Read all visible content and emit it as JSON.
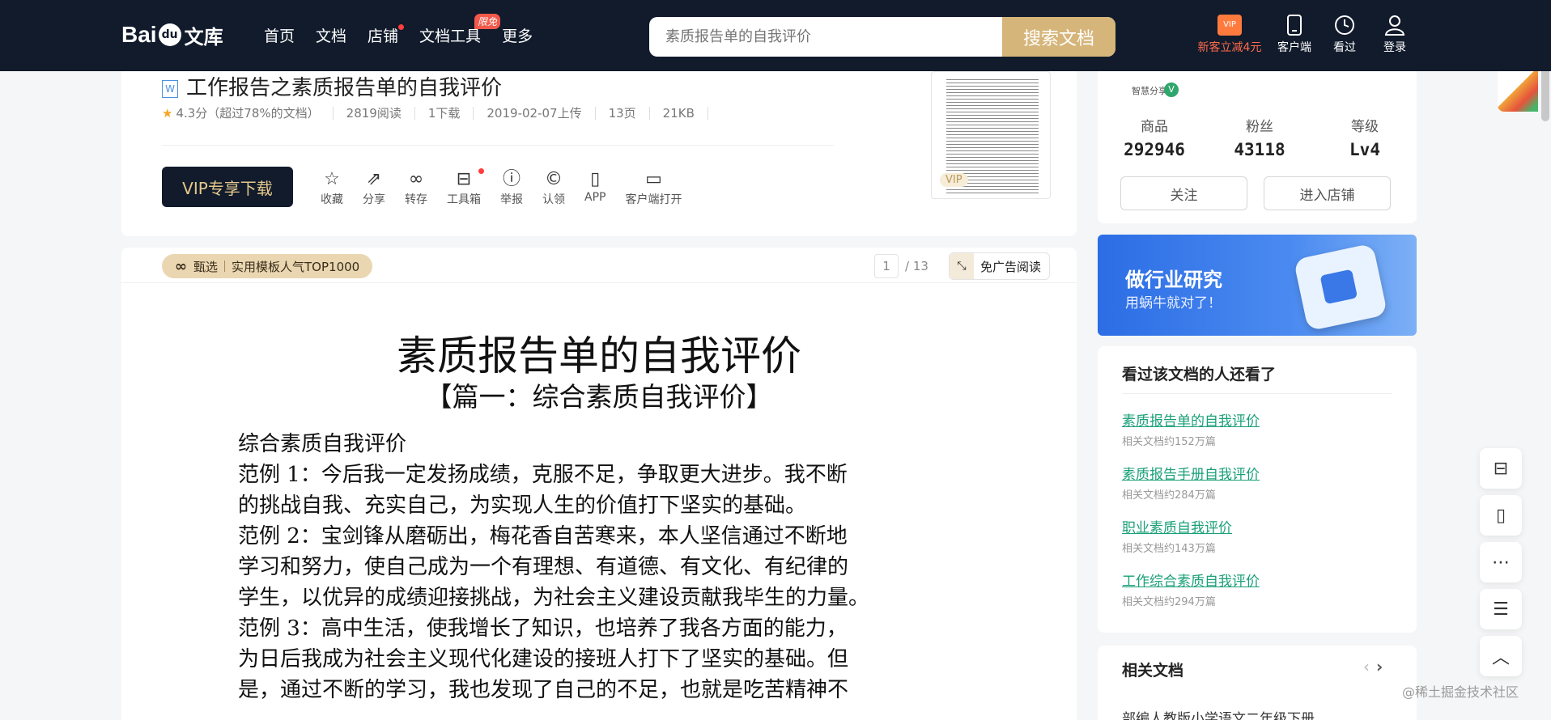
{
  "header": {
    "logo_bai": "Bai",
    "logo_du": "du",
    "logo_wenku": "文库",
    "nav": [
      {
        "label": "首页"
      },
      {
        "label": "文档"
      },
      {
        "label": "店铺"
      },
      {
        "label": "文档工具",
        "tag": "限免"
      },
      {
        "label": "更多"
      }
    ],
    "search_placeholder": "素质报告单的自我评价",
    "search_button": "搜索文档",
    "vip_promo": "新客立减4元",
    "vip_gift_text": "VIP",
    "tools": [
      {
        "label": "客户端",
        "icon": "tablet-icon"
      },
      {
        "label": "看过",
        "icon": "clock-icon"
      },
      {
        "label": "登录",
        "icon": "user-icon"
      }
    ]
  },
  "doc": {
    "type_icon": "W",
    "title": "工作报告之素质报告单的自我评价",
    "meta": {
      "rating": "4.3分（超过78%的文档）",
      "reads": "2819阅读",
      "downloads": "1下载",
      "upload_date": "2019-02-07上传",
      "pages": "13页",
      "size": "21KB"
    },
    "vip_download": "VIP专享下载",
    "actions": [
      {
        "label": "收藏",
        "icon": "☆"
      },
      {
        "label": "分享",
        "icon": "⇗"
      },
      {
        "label": "转存",
        "icon": "∞"
      },
      {
        "label": "工具箱",
        "icon": "⊟"
      },
      {
        "label": "举报",
        "icon": "ⓘ"
      },
      {
        "label": "认领",
        "icon": "©"
      },
      {
        "label": "APP",
        "icon": "▯"
      },
      {
        "label": "客户端打开",
        "icon": "▭"
      }
    ],
    "thumb_tag": "VIP"
  },
  "reader": {
    "zhenxuan": "甄选",
    "zhenxuan_sub": "实用模板人气TOP1000",
    "page_current": "1",
    "page_total": "/ 13",
    "noad_label": "免广告阅读",
    "page_title": "素质报告单的自我评价",
    "page_subtitle": "【篇一：综合素质自我评价】",
    "body": [
      " 综合素质自我评价",
      " 范例 1：今后我一定发扬成绩，克服不足，争取更大进步。我不断",
      "的挑战自我、充实自己，为实现人生的价值打下坚实的基础。",
      " 范例 2：宝剑锋从磨砺出，梅花香自苦寒来，本人坚信通过不断地",
      "学习和努力，使自己成为一个有理想、有道德、有文化、有纪律的",
      "学生，以优异的成绩迎接挑战，为社会主义建设贡献我毕生的力量。",
      " 范例 3：高中生活，使我增长了知识，也培养了我各方面的能力，",
      "为日后我成为社会主义现代化建设的接班人打下了坚实的基础。但",
      "是，通过不断的学习，我也发现了自己的不足，也就是吃苦精神不"
    ]
  },
  "shop": {
    "name": "智慧分享",
    "stats": [
      {
        "label": "商品",
        "value": "292946"
      },
      {
        "label": "粉丝",
        "value": "43118"
      },
      {
        "label": "等级",
        "value": "Lv4"
      }
    ],
    "follow": "关注",
    "enter": "进入店铺"
  },
  "banner": {
    "line1": "做行业研究",
    "line2": "用蜗牛就对了！"
  },
  "related_viewed": {
    "title": "看过该文档的人还看了",
    "items": [
      {
        "title": "素质报告单的自我评价",
        "count": "相关文档约152万篇"
      },
      {
        "title": "素质报告手册自我评价",
        "count": "相关文档约284万篇"
      },
      {
        "title": "职业素质自我评价",
        "count": "相关文档约143万篇"
      },
      {
        "title": "工作综合素质自我评价",
        "count": "相关文档约294万篇"
      }
    ]
  },
  "related_docs": {
    "title": "相关文档",
    "first_item": "部编人教版小学语文二年级下册"
  },
  "watermark": "@稀土掘金技术社区"
}
